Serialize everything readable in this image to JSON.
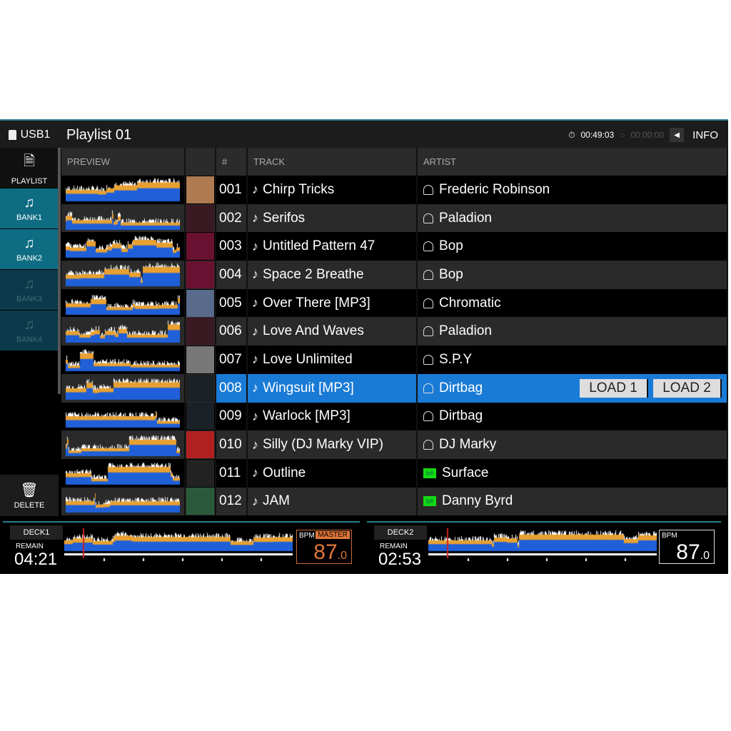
{
  "header": {
    "source": "USB1",
    "title": "Playlist 01",
    "elapsed": "00:49:03",
    "timer2": "00:00:00",
    "info_label": "INFO"
  },
  "sidebar": {
    "items": [
      {
        "label": "PLAYLIST",
        "state": "normal"
      },
      {
        "label": "BANK1",
        "state": "active"
      },
      {
        "label": "BANK2",
        "state": "active"
      },
      {
        "label": "BANK3",
        "state": "disabled"
      },
      {
        "label": "BANK4",
        "state": "disabled"
      }
    ],
    "delete_label": "DELETE"
  },
  "table": {
    "columns": [
      "PREVIEW",
      "",
      "#",
      "TRACK",
      "ARTIST"
    ],
    "rows": [
      {
        "num": "001",
        "track": "Chirp Tricks",
        "artist": "Frederic Robinson",
        "artist_icon": "person",
        "art": "#b07a50"
      },
      {
        "num": "002",
        "track": "Serifos",
        "artist": "Paladion",
        "artist_icon": "person",
        "art": "#3a1a22"
      },
      {
        "num": "003",
        "track": "Untitled Pattern 47",
        "artist": "Bop",
        "artist_icon": "person",
        "art": "#6a1030"
      },
      {
        "num": "004",
        "track": "Space 2 Breathe",
        "artist": "Bop",
        "artist_icon": "person",
        "art": "#6a1030"
      },
      {
        "num": "005",
        "track": "Over There [MP3]",
        "artist": "Chromatic",
        "artist_icon": "person",
        "art": "#5a6a8a"
      },
      {
        "num": "006",
        "track": "Love And Waves",
        "artist": "Paladion",
        "artist_icon": "person",
        "art": "#3a1a22"
      },
      {
        "num": "007",
        "track": "Love Unlimited",
        "artist": "S.P.Y",
        "artist_icon": "person",
        "art": "#777777"
      },
      {
        "num": "008",
        "track": "Wingsuit [MP3]",
        "artist": "Dirtbag",
        "artist_icon": "person",
        "art": "#1a2228",
        "selected": true
      },
      {
        "num": "009",
        "track": "Warlock [MP3]",
        "artist": "Dirtbag",
        "artist_icon": "person",
        "art": "#1a2228"
      },
      {
        "num": "010",
        "track": "Silly (DJ Marky VIP)",
        "artist": "DJ Marky",
        "artist_icon": "person",
        "art": "#b02020"
      },
      {
        "num": "011",
        "track": "Outline",
        "artist": "Surface",
        "artist_icon": "key-flat-sharp",
        "art": "#222222"
      },
      {
        "num": "012",
        "track": "JAM",
        "artist": "Danny Byrd",
        "artist_icon": "key-flat-sharp",
        "art": "#2a5a3a"
      }
    ],
    "load_buttons": [
      "LOAD 1",
      "LOAD 2"
    ]
  },
  "decks": [
    {
      "label": "DECK1",
      "remain_label": "REMAIN",
      "time": "04:21",
      "bpm_label": "BPM",
      "master_label": "MASTER",
      "bpm": "87",
      "bpm_decimal": ".0",
      "accent": "#e0763a"
    },
    {
      "label": "DECK2",
      "remain_label": "REMAIN",
      "time": "02:53",
      "bpm_label": "BPM",
      "master_label": "",
      "bpm": "87",
      "bpm_decimal": ".0",
      "accent": "#ffffff"
    }
  ],
  "colors": {
    "selected_row": "#1a7bd6",
    "bank": "#0e6d82",
    "waveform_blue": "#1f5fd8",
    "waveform_orange": "#e8a030"
  }
}
